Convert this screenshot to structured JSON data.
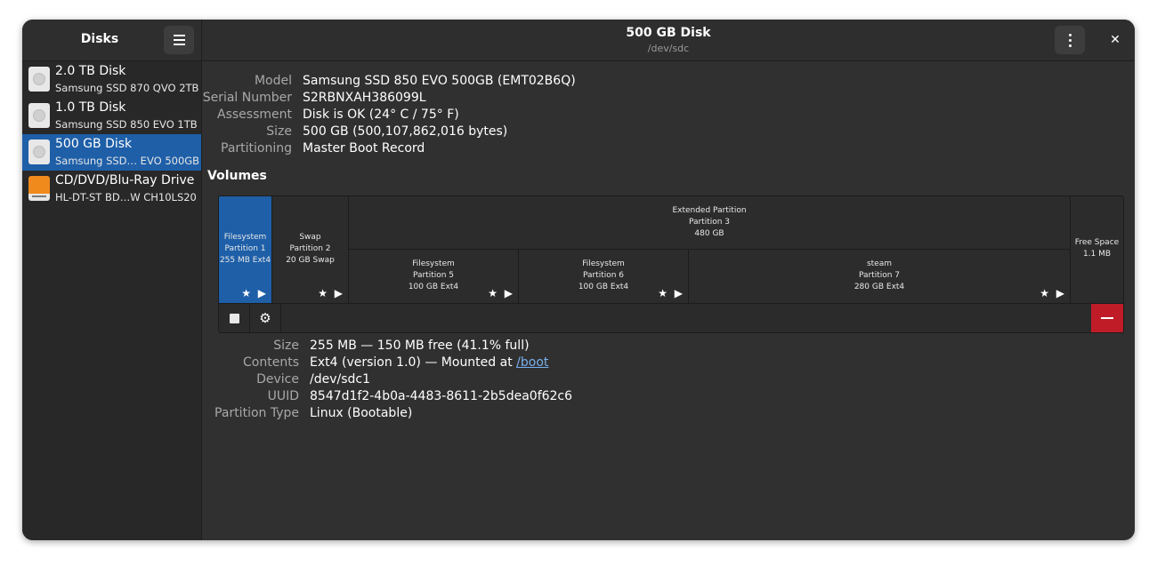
{
  "sidebar": {
    "title": "Disks",
    "menu_icon": "hamburger-menu-icon",
    "disks": [
      {
        "name": "2.0 TB Disk",
        "model": "Samsung SSD 870 QVO 2TB"
      },
      {
        "name": "1.0 TB Disk",
        "model": "Samsung SSD 850 EVO 1TB"
      },
      {
        "name": "500 GB Disk",
        "model": "Samsung SSD… EVO 500GB"
      },
      {
        "name": "CD/DVD/Blu-Ray Drive",
        "model": "HL-DT-ST BD…W CH10LS20"
      }
    ]
  },
  "header": {
    "title": "500 GB Disk",
    "subtitle": "/dev/sdc",
    "close_label": "✕"
  },
  "disk_info": {
    "labels": [
      "Model",
      "Serial Number",
      "Assessment",
      "Size",
      "Partitioning"
    ],
    "values": [
      "Samsung SSD 850 EVO 500GB (EMT02B6Q)",
      "S2RBNXAH386099L",
      "Disk is OK (24° C / 75° F)",
      "500 GB (500,107,862,016 bytes)",
      "Master Boot Record"
    ]
  },
  "volumes": {
    "heading": "Volumes",
    "partitions": [
      {
        "line1": "Filesystem",
        "line2": "Partition 1",
        "line3": "255 MB Ext4"
      },
      {
        "line1": "Swap",
        "line2": "Partition 2",
        "line3": "20 GB Swap"
      },
      {
        "line1": "Extended Partition",
        "line2": "Partition 3",
        "line3": "480 GB"
      },
      {
        "line1": "Filesystem",
        "line2": "Partition 5",
        "line3": "100 GB Ext4"
      },
      {
        "line1": "Filesystem",
        "line2": "Partition 6",
        "line3": "100 GB Ext4"
      },
      {
        "line1": "steam",
        "line2": "Partition 7",
        "line3": "280 GB Ext4"
      },
      {
        "line1": "Free Space",
        "line2": "1.1 MB"
      }
    ],
    "status_icons": "★ ▶",
    "toolbar": {
      "settings_glyph": "⚙"
    }
  },
  "partition_info": {
    "labels": [
      "Size",
      "Contents",
      "Device",
      "UUID",
      "Partition Type"
    ],
    "size": "255 MB — 150 MB free (41.1% full)",
    "contents_prefix": "Ext4 (version 1.0) — Mounted at ",
    "mount_link": "/boot",
    "device": "/dev/sdc1",
    "uuid": "8547d1f2-4b0a-4483-8611-2b5dea0f62c6",
    "partition_type": "Linux (Bootable)"
  },
  "colors": {
    "accent": "#1e5fa8",
    "destructive": "#c01c28",
    "optical_icon": "#f08a1c"
  }
}
